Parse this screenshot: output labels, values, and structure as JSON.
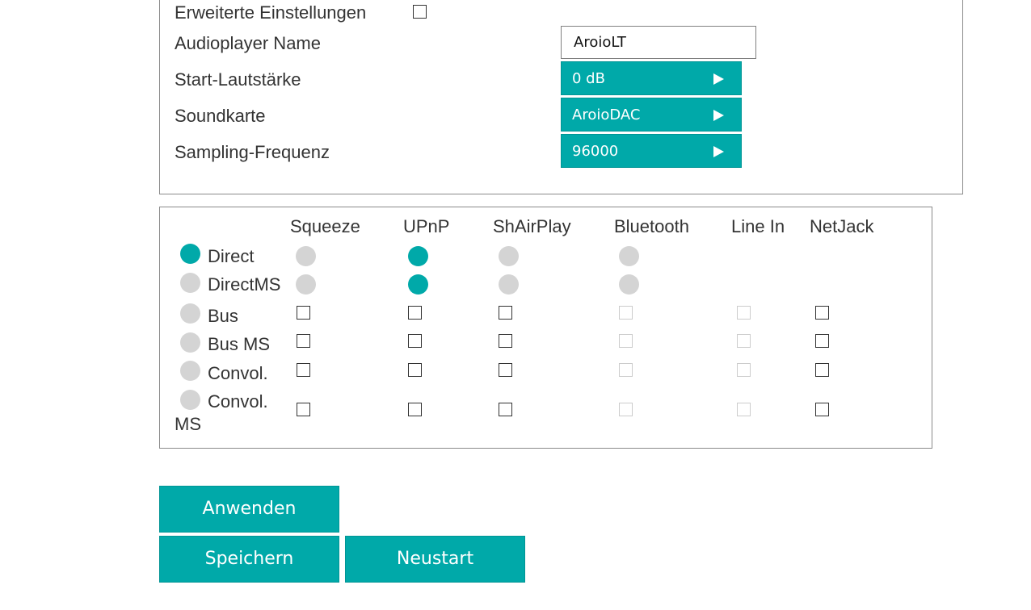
{
  "settings": {
    "advanced_label": "Erweiterte Einstellungen",
    "advanced_checked": false,
    "player_name_label": "Audioplayer Name",
    "player_name_value": "AroioLT",
    "start_volume_label": "Start-Lautstärke",
    "start_volume_value": "0 dB",
    "soundcard_label": "Soundkarte",
    "soundcard_value": "AroioDAC",
    "sampling_label": "Sampling-Frequenz",
    "sampling_value": "96000"
  },
  "matrix": {
    "columns": [
      "Squeeze",
      "UPnP",
      "ShAirPlay",
      "Bluetooth",
      "Line In",
      "NetJack"
    ],
    "rows": [
      {
        "label": "Direct",
        "selected": true,
        "type": "radio",
        "cells": [
          "off",
          "on",
          "off",
          "off",
          null,
          null
        ]
      },
      {
        "label": "DirectMS",
        "selected": false,
        "type": "radio",
        "cells": [
          "off",
          "on",
          "off",
          "off",
          null,
          null
        ]
      },
      {
        "label": "Bus",
        "selected": false,
        "type": "checkbox",
        "cells": [
          "enabled",
          "enabled",
          "enabled",
          "disabled",
          "disabled",
          "enabled"
        ]
      },
      {
        "label": "Bus MS",
        "selected": false,
        "type": "checkbox",
        "cells": [
          "enabled",
          "enabled",
          "enabled",
          "disabled",
          "disabled",
          "enabled"
        ]
      },
      {
        "label": "Convol.",
        "selected": false,
        "type": "checkbox",
        "cells": [
          "enabled",
          "enabled",
          "enabled",
          "disabled",
          "disabled",
          "enabled"
        ]
      },
      {
        "label_line1": "Convol.",
        "label_line2": "MS",
        "selected": false,
        "type": "checkbox",
        "cells": [
          "enabled",
          "enabled",
          "enabled",
          "disabled",
          "disabled",
          "enabled"
        ]
      }
    ]
  },
  "buttons": {
    "apply": "Anwenden",
    "save": "Speichern",
    "restart": "Neustart"
  },
  "colors": {
    "accent": "#00a9a9",
    "inactive": "#d4d4d4"
  }
}
